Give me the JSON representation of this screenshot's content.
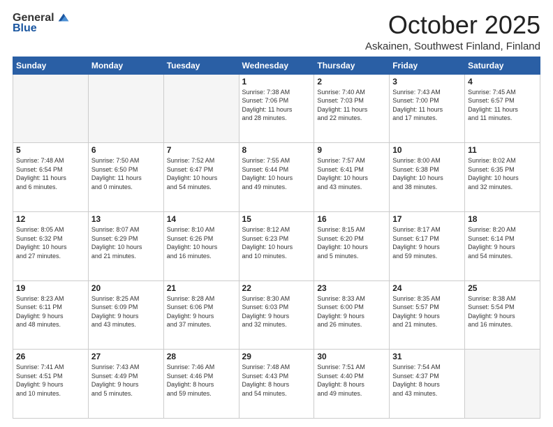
{
  "logo": {
    "general": "General",
    "blue": "Blue"
  },
  "header": {
    "month": "October 2025",
    "location": "Askainen, Southwest Finland, Finland"
  },
  "weekdays": [
    "Sunday",
    "Monday",
    "Tuesday",
    "Wednesday",
    "Thursday",
    "Friday",
    "Saturday"
  ],
  "weeks": [
    [
      {
        "day": "",
        "info": ""
      },
      {
        "day": "",
        "info": ""
      },
      {
        "day": "",
        "info": ""
      },
      {
        "day": "1",
        "info": "Sunrise: 7:38 AM\nSunset: 7:06 PM\nDaylight: 11 hours\nand 28 minutes."
      },
      {
        "day": "2",
        "info": "Sunrise: 7:40 AM\nSunset: 7:03 PM\nDaylight: 11 hours\nand 22 minutes."
      },
      {
        "day": "3",
        "info": "Sunrise: 7:43 AM\nSunset: 7:00 PM\nDaylight: 11 hours\nand 17 minutes."
      },
      {
        "day": "4",
        "info": "Sunrise: 7:45 AM\nSunset: 6:57 PM\nDaylight: 11 hours\nand 11 minutes."
      }
    ],
    [
      {
        "day": "5",
        "info": "Sunrise: 7:48 AM\nSunset: 6:54 PM\nDaylight: 11 hours\nand 6 minutes."
      },
      {
        "day": "6",
        "info": "Sunrise: 7:50 AM\nSunset: 6:50 PM\nDaylight: 11 hours\nand 0 minutes."
      },
      {
        "day": "7",
        "info": "Sunrise: 7:52 AM\nSunset: 6:47 PM\nDaylight: 10 hours\nand 54 minutes."
      },
      {
        "day": "8",
        "info": "Sunrise: 7:55 AM\nSunset: 6:44 PM\nDaylight: 10 hours\nand 49 minutes."
      },
      {
        "day": "9",
        "info": "Sunrise: 7:57 AM\nSunset: 6:41 PM\nDaylight: 10 hours\nand 43 minutes."
      },
      {
        "day": "10",
        "info": "Sunrise: 8:00 AM\nSunset: 6:38 PM\nDaylight: 10 hours\nand 38 minutes."
      },
      {
        "day": "11",
        "info": "Sunrise: 8:02 AM\nSunset: 6:35 PM\nDaylight: 10 hours\nand 32 minutes."
      }
    ],
    [
      {
        "day": "12",
        "info": "Sunrise: 8:05 AM\nSunset: 6:32 PM\nDaylight: 10 hours\nand 27 minutes."
      },
      {
        "day": "13",
        "info": "Sunrise: 8:07 AM\nSunset: 6:29 PM\nDaylight: 10 hours\nand 21 minutes."
      },
      {
        "day": "14",
        "info": "Sunrise: 8:10 AM\nSunset: 6:26 PM\nDaylight: 10 hours\nand 16 minutes."
      },
      {
        "day": "15",
        "info": "Sunrise: 8:12 AM\nSunset: 6:23 PM\nDaylight: 10 hours\nand 10 minutes."
      },
      {
        "day": "16",
        "info": "Sunrise: 8:15 AM\nSunset: 6:20 PM\nDaylight: 10 hours\nand 5 minutes."
      },
      {
        "day": "17",
        "info": "Sunrise: 8:17 AM\nSunset: 6:17 PM\nDaylight: 9 hours\nand 59 minutes."
      },
      {
        "day": "18",
        "info": "Sunrise: 8:20 AM\nSunset: 6:14 PM\nDaylight: 9 hours\nand 54 minutes."
      }
    ],
    [
      {
        "day": "19",
        "info": "Sunrise: 8:23 AM\nSunset: 6:11 PM\nDaylight: 9 hours\nand 48 minutes."
      },
      {
        "day": "20",
        "info": "Sunrise: 8:25 AM\nSunset: 6:09 PM\nDaylight: 9 hours\nand 43 minutes."
      },
      {
        "day": "21",
        "info": "Sunrise: 8:28 AM\nSunset: 6:06 PM\nDaylight: 9 hours\nand 37 minutes."
      },
      {
        "day": "22",
        "info": "Sunrise: 8:30 AM\nSunset: 6:03 PM\nDaylight: 9 hours\nand 32 minutes."
      },
      {
        "day": "23",
        "info": "Sunrise: 8:33 AM\nSunset: 6:00 PM\nDaylight: 9 hours\nand 26 minutes."
      },
      {
        "day": "24",
        "info": "Sunrise: 8:35 AM\nSunset: 5:57 PM\nDaylight: 9 hours\nand 21 minutes."
      },
      {
        "day": "25",
        "info": "Sunrise: 8:38 AM\nSunset: 5:54 PM\nDaylight: 9 hours\nand 16 minutes."
      }
    ],
    [
      {
        "day": "26",
        "info": "Sunrise: 7:41 AM\nSunset: 4:51 PM\nDaylight: 9 hours\nand 10 minutes."
      },
      {
        "day": "27",
        "info": "Sunrise: 7:43 AM\nSunset: 4:49 PM\nDaylight: 9 hours\nand 5 minutes."
      },
      {
        "day": "28",
        "info": "Sunrise: 7:46 AM\nSunset: 4:46 PM\nDaylight: 8 hours\nand 59 minutes."
      },
      {
        "day": "29",
        "info": "Sunrise: 7:48 AM\nSunset: 4:43 PM\nDaylight: 8 hours\nand 54 minutes."
      },
      {
        "day": "30",
        "info": "Sunrise: 7:51 AM\nSunset: 4:40 PM\nDaylight: 8 hours\nand 49 minutes."
      },
      {
        "day": "31",
        "info": "Sunrise: 7:54 AM\nSunset: 4:37 PM\nDaylight: 8 hours\nand 43 minutes."
      },
      {
        "day": "",
        "info": ""
      }
    ]
  ]
}
